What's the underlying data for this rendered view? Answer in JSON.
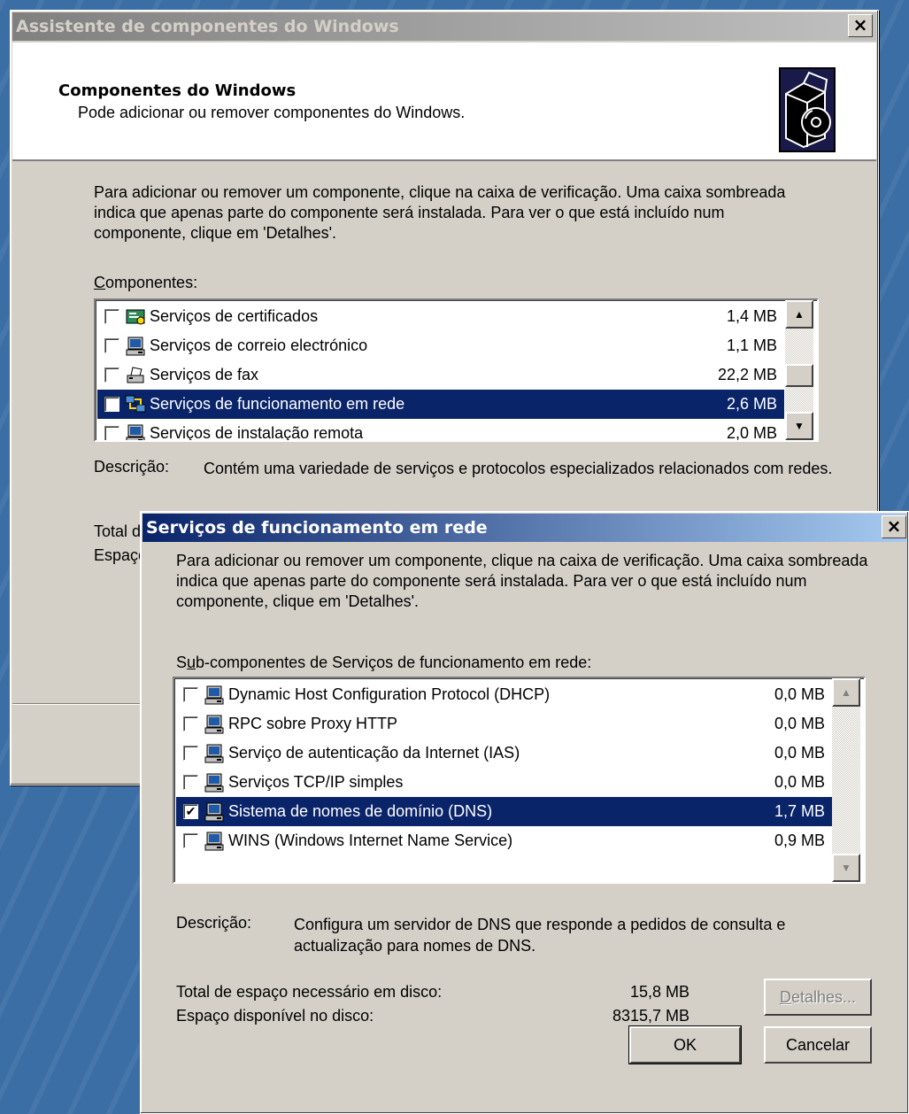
{
  "main_dialog": {
    "title": "Assistente de  componentes do Windows",
    "close_label": "×",
    "header_title": "Componentes do Windows",
    "header_subtitle": "Pode adicionar ou remover componentes do Windows.",
    "intro": "Para adicionar ou remover um componente, clique na caixa de verificação. Uma caixa sombreada indica que apenas parte do componente será instalada. Para ver o que está incluído num componente, clique em 'Detalhes'.",
    "components_label_first": "C",
    "components_label_rest": "omponentes:",
    "components": [
      {
        "label": "Serviços de certificados",
        "size": "1,4 MB",
        "checked": false,
        "icon": "certificate-icon"
      },
      {
        "label": "Serviços de correio electrónico",
        "size": "1,1 MB",
        "checked": false,
        "icon": "computer-icon"
      },
      {
        "label": "Serviços de fax",
        "size": "22,2 MB",
        "checked": false,
        "icon": "fax-icon"
      },
      {
        "label": "Serviços de funcionamento em rede",
        "size": "2,6 MB",
        "checked": false,
        "icon": "network-icon",
        "selected": true
      },
      {
        "label": "Serviços de instalação remota",
        "size": "2,0 MB",
        "checked": false,
        "icon": "computer-icon"
      }
    ],
    "description_label": "Descrição:",
    "description": "Contém uma variedade de serviços e protocolos especializados relacionados com redes.",
    "total_label_partial": "Total d",
    "space_label_partial": "Espaço"
  },
  "sub_dialog": {
    "title": "Serviços de funcionamento em rede",
    "close_label": "×",
    "intro": "Para adicionar ou remover um componente, clique na caixa de verificação. Uma caixa sombreada indica que apenas parte do componente será instalada. Para ver o que está incluído num componente, clique em 'Detalhes'.",
    "subcomponents_label_first": "S",
    "subcomponents_label_u": "u",
    "subcomponents_label_rest": "b-componentes de Serviços de funcionamento em rede:",
    "subcomponents": [
      {
        "label": "Dynamic Host Configuration Protocol (DHCP)",
        "size": "0,0 MB",
        "checked": false,
        "icon": "computer-icon"
      },
      {
        "label": "RPC sobre Proxy HTTP",
        "size": "0,0 MB",
        "checked": false,
        "icon": "computer-icon"
      },
      {
        "label": "Serviço de autenticação da Internet (IAS)",
        "size": "0,0 MB",
        "checked": false,
        "icon": "computer-icon"
      },
      {
        "label": "Serviços TCP/IP simples",
        "size": "0,0 MB",
        "checked": false,
        "icon": "computer-icon"
      },
      {
        "label": "Sistema de nomes de domínio (DNS)",
        "size": "1,7 MB",
        "checked": true,
        "icon": "computer-icon",
        "selected": true
      },
      {
        "label": "WINS (Windows Internet Name Service)",
        "size": "0,9 MB",
        "checked": false,
        "icon": "computer-icon"
      }
    ],
    "description_label": "Descrição:",
    "description": "Configura um servidor de DNS que responde a pedidos de consulta e actualização para nomes de DNS.",
    "total_required_label": "Total de espaço necessário em disco:",
    "total_required_value": "15,8 MB",
    "available_label": "Espaço disponível no disco:",
    "available_value": "8315,7 MB",
    "details_button_first": "D",
    "details_button_rest": "etalhes...",
    "ok_label": "OK",
    "cancel_label": "Cancelar"
  },
  "colors": {
    "desktop": "#3a6ea5",
    "title_active_start": "#0a246a",
    "title_active_end": "#a6caf0",
    "title_inactive_start": "#808080",
    "title_inactive_end": "#c0c0c0",
    "selection": "#0a246a",
    "face": "#d4d0c8"
  }
}
